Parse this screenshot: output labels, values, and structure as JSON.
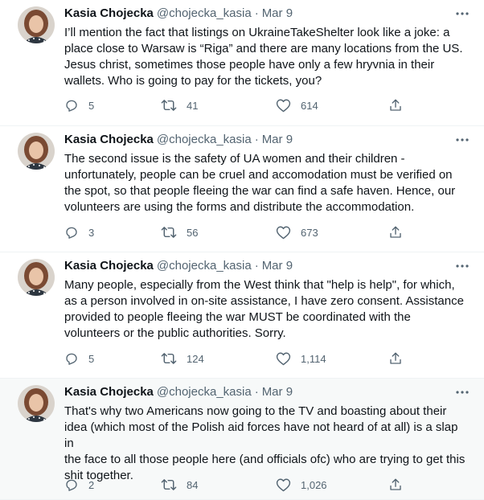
{
  "tweets": [
    {
      "author_name": "Kasia Chojecka",
      "handle": "@chojecka_kasia",
      "separator": "·",
      "date": "Mar 9",
      "lines": [
        "I’ll mention the fact that listings on UkraineTakeShelter look like a joke: a",
        "place close to Warsaw is “Riga” and there are many locations from the US.",
        "Jesus christ, sometimes those people have only a few hryvnia in their",
        "wallets. Who is going to pay for the tickets, you?"
      ],
      "replies": "5",
      "retweets": "41",
      "likes": "614"
    },
    {
      "author_name": "Kasia Chojecka",
      "handle": "@chojecka_kasia",
      "separator": "·",
      "date": "Mar 9",
      "lines": [
        "The second issue is the safety of UA women and their children -",
        "unfortunately, people can be cruel and accomodation must be verified on",
        "the spot, so that people fleeing the war can find a safe haven. Hence, our",
        "volunteers are using the forms and distribute the accommodation."
      ],
      "replies": "3",
      "retweets": "56",
      "likes": "673"
    },
    {
      "author_name": "Kasia Chojecka",
      "handle": "@chojecka_kasia",
      "separator": "·",
      "date": "Mar 9",
      "lines": [
        "Many people, especially from the West think that \"help is help\", for which,",
        "as a person involved in on-site assistance, I have zero consent. Assistance",
        "provided to people fleeing the war MUST be coordinated with the",
        "volunteers or the public authorities. Sorry."
      ],
      "replies": "5",
      "retweets": "124",
      "likes": "1,114"
    },
    {
      "author_name": "Kasia Chojecka",
      "handle": "@chojecka_kasia",
      "separator": "·",
      "date": "Mar 9",
      "lines": [
        "That's why two Americans now going to the TV and boasting about their",
        "idea (which most of the Polish aid forces have not heard of at all) is a slap in",
        "the face to all those people here (and officials ofc) who are trying to get this",
        "shit together."
      ],
      "replies": "2",
      "retweets": "84",
      "likes": "1,026"
    }
  ],
  "icons": {
    "more": "more-icon",
    "reply": "reply-icon",
    "retweet": "retweet-icon",
    "like": "like-icon",
    "share": "share-icon"
  },
  "colors": {
    "text": "#0f1419",
    "secondary": "#536471",
    "divider": "#eff3f4",
    "highlight_bg": "#f7f9f9"
  }
}
